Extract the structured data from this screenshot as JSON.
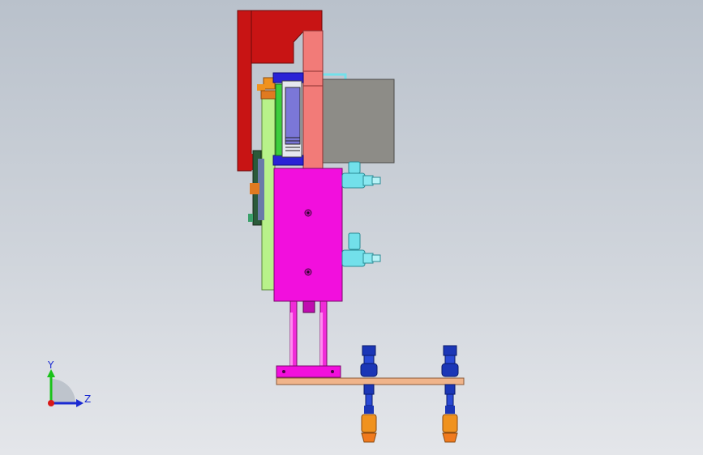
{
  "colors": {
    "red_bracket": "#c81414",
    "salmon_plate": "#f27b78",
    "grey_motor": "#8d8c87",
    "magenta_cylinder": "#f20fdd",
    "light_green_plate": "#b8f28a",
    "green_plate": "#3ccf3c",
    "blue_part": "#2a22d6",
    "cyan_fitting": "#72e0ea",
    "copper_bar": "#f0b48a",
    "orange_cup": "#f0921e",
    "navy_ejector": "#1b36b6"
  },
  "triad": {
    "y_label": "Y",
    "z_label": "Z",
    "y_color": "#1ac21a",
    "z_color": "#1a2ad2",
    "origin_color": "#d81818"
  }
}
